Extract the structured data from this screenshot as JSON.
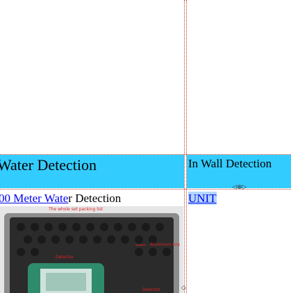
{
  "table": {
    "header_left": "Water Detection",
    "header_right": "In Wall Detection",
    "row_left_link": "00 Meter Wate",
    "row_left_rest": "r Detection",
    "row_right_link": "UNIT"
  },
  "image": {
    "caption_top": "The whole set packing list",
    "label_box": "Aluminum box",
    "label_device": "Detector",
    "label_bottom": "Detector"
  },
  "colors": {
    "header_bg": "#33ccff",
    "grid_line": "#c0392b",
    "link": "#0000ee"
  }
}
